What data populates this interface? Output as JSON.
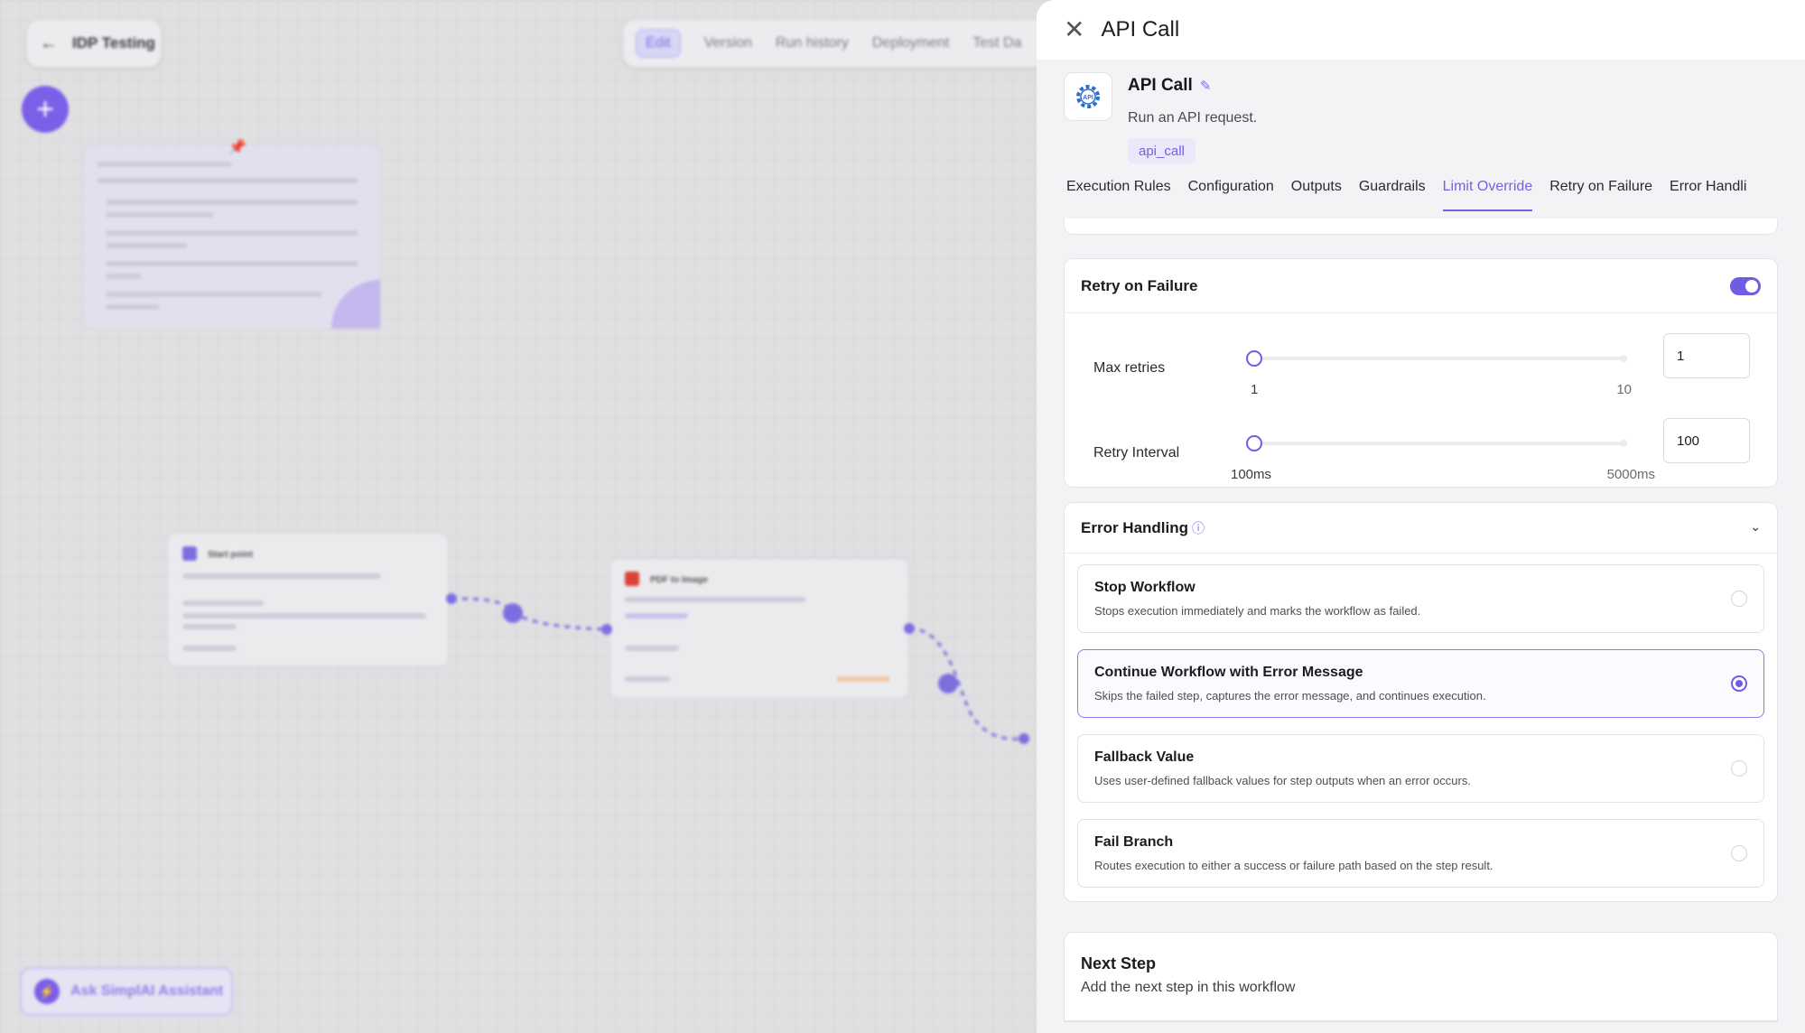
{
  "canvas": {
    "project_name": "IDP Testing",
    "top_tabs": [
      "Edit",
      "Version",
      "Run history",
      "Deployment",
      "Test Da"
    ],
    "ask_assistant": "Ask SimplAI Assistant",
    "start_node_title": "Start point",
    "pdf_node_title": "PDF to Image"
  },
  "panel": {
    "title": "API Call",
    "step": {
      "name": "API Call",
      "description": "Run an API request.",
      "badge": "api_call",
      "icon": "gear-api-icon"
    },
    "tabs": [
      {
        "label": "Execution Rules",
        "active": false
      },
      {
        "label": "Configuration",
        "active": false
      },
      {
        "label": "Outputs",
        "active": false
      },
      {
        "label": "Guardrails",
        "active": false
      },
      {
        "label": "Limit Override",
        "active": true
      },
      {
        "label": "Retry on Failure",
        "active": false
      },
      {
        "label": "Error Handli",
        "active": false
      }
    ],
    "retry": {
      "title": "Retry on Failure",
      "enabled": true,
      "max_retries": {
        "label": "Max retries",
        "min": "1",
        "max": "10",
        "value": "1",
        "fraction": 0.0
      },
      "retry_interval": {
        "label": "Retry Interval",
        "min": "100ms",
        "max": "5000ms",
        "value": "100",
        "fraction": 0.0
      }
    },
    "error_handling": {
      "title": "Error Handling",
      "options": [
        {
          "title": "Stop Workflow",
          "desc": "Stops execution immediately and marks the workflow as failed.",
          "selected": false
        },
        {
          "title": "Continue Workflow with Error Message",
          "desc": "Skips the failed step, captures the error message, and continues execution.",
          "selected": true
        },
        {
          "title": "Fallback Value",
          "desc": "Uses user-defined fallback values for step outputs when an error occurs.",
          "selected": false
        },
        {
          "title": "Fail Branch",
          "desc": "Routes execution to either a success or failure path based on the step result.",
          "selected": false
        }
      ]
    },
    "next_step": {
      "title": "Next Step",
      "desc": "Add the next step in this workflow"
    }
  },
  "colors": {
    "accent": "#6f5ce4",
    "panel_bg": "#f3f3f6",
    "canvas_bg": "#e0e0e2"
  }
}
